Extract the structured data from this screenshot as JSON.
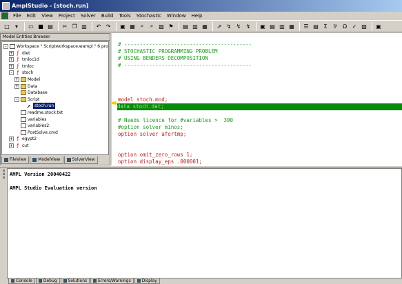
{
  "window": {
    "title": "AmplStudio - [stoch.run]"
  },
  "menu": [
    "File",
    "Edit",
    "View",
    "Project",
    "Solver",
    "Build",
    "Tools",
    "Stochastic",
    "Window",
    "Help"
  ],
  "explorer": {
    "title": "Model Entities Browser",
    "tree": [
      {
        "label": "Workspace \" Scriptworkspace.wampl \" 6 project(s)",
        "kind": "workspace",
        "expander": "-",
        "indent": 0
      },
      {
        "label": "diet",
        "kind": "project",
        "expander": "+",
        "indent": 1
      },
      {
        "label": "trnloc1d",
        "kind": "project",
        "expander": "+",
        "indent": 1
      },
      {
        "label": "trnloc",
        "kind": "project",
        "expander": "+",
        "indent": 1
      },
      {
        "label": "stoch",
        "kind": "project",
        "expander": "-",
        "indent": 1
      },
      {
        "label": "Model",
        "kind": "folder",
        "expander": "+",
        "indent": 2
      },
      {
        "label": "Data",
        "kind": "folder",
        "expander": "+",
        "indent": 2
      },
      {
        "label": "Database",
        "kind": "folder",
        "expander": "",
        "indent": 2
      },
      {
        "label": "Script",
        "kind": "folder",
        "expander": "-",
        "indent": 2
      },
      {
        "label": "stoch.run",
        "kind": "run",
        "expander": "",
        "indent": 3,
        "selected": true
      },
      {
        "label": "readme.stock.txt",
        "kind": "doc",
        "expander": "",
        "indent": 2
      },
      {
        "label": "variables",
        "kind": "doc",
        "expander": "",
        "indent": 2
      },
      {
        "label": "variables2",
        "kind": "doc",
        "expander": "",
        "indent": 2
      },
      {
        "label": "PostSolve.cmd",
        "kind": "doc",
        "expander": "",
        "indent": 2
      },
      {
        "label": "egypt2",
        "kind": "project",
        "expander": "+",
        "indent": 1
      },
      {
        "label": "cut",
        "kind": "project",
        "expander": "+",
        "indent": 1
      }
    ],
    "tabs": [
      "FileView",
      "ModelView",
      "SolverView"
    ]
  },
  "editor": {
    "lines": [
      {
        "text": "# -----------------------------------------",
        "cls": "c"
      },
      {
        "text": "# STOCHASTIC PROGRAMMING PROBLEM",
        "cls": "c"
      },
      {
        "text": "# USING BENDERS DECOMPOSITION",
        "cls": "c"
      },
      {
        "text": "# -----------------------------------------",
        "cls": "c"
      },
      {
        "text": "",
        "cls": "c"
      },
      {
        "text": "",
        "cls": "c"
      },
      {
        "text": "",
        "cls": "c"
      },
      {
        "text": "",
        "cls": "c"
      },
      {
        "text": "model stoch.mod;",
        "cls": "k"
      },
      {
        "text": "data stoch.dat;",
        "cls": "h"
      },
      {
        "text": "",
        "cls": "c"
      },
      {
        "text": "# Needs licence for #variables >  300",
        "cls": "c"
      },
      {
        "text": "#option solver minos;",
        "cls": "c"
      },
      {
        "text": "option solver afortmp;",
        "cls": "k"
      },
      {
        "text": "",
        "cls": "c"
      },
      {
        "text": "",
        "cls": "c"
      },
      {
        "text": "option omit_zero_rows 1;",
        "cls": "k"
      },
      {
        "text": "option display_eps .000001;",
        "cls": "k"
      }
    ]
  },
  "output": {
    "lines": [
      "AMPL Version 20040422",
      "",
      "AMPL Studio Evaluation version"
    ]
  },
  "bottom_tabs": [
    "Console",
    "Debug",
    "Solutions",
    "Errors/Warnings",
    "Display"
  ],
  "colors": {
    "comment": "#1a9a1a",
    "keyword": "#b02020",
    "highlight": "#0a8a0a",
    "titlebar": "#0a246a"
  }
}
